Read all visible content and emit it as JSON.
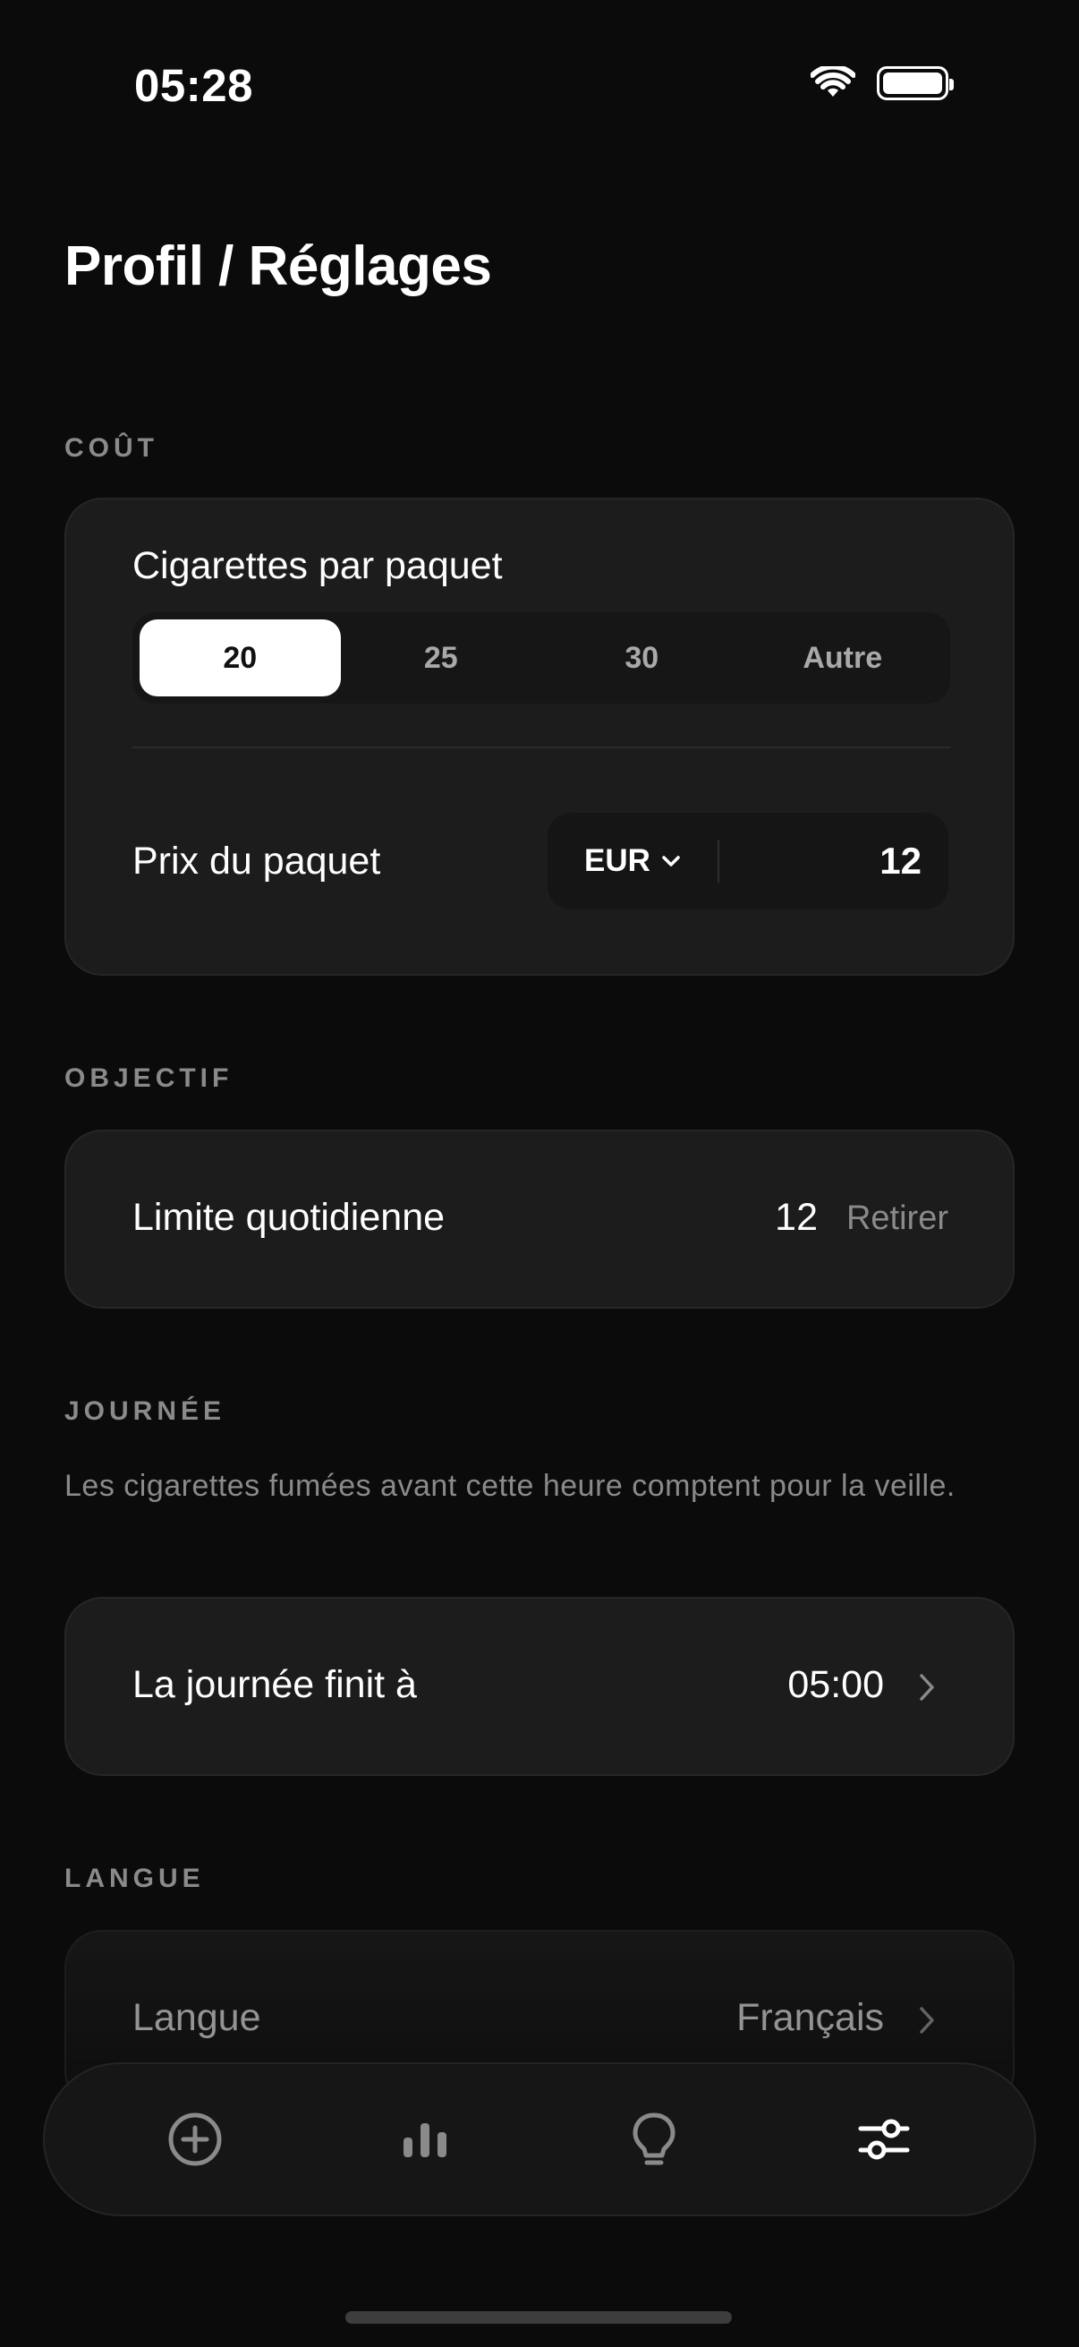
{
  "status_bar": {
    "time": "05:28",
    "wifi_icon": "wifi-icon",
    "battery_icon": "battery-icon"
  },
  "page": {
    "title": "Profil / Réglages"
  },
  "cost": {
    "section_label": "COÛT",
    "cigs_per_pack_label": "Cigarettes par paquet",
    "pack_options": [
      "20",
      "25",
      "30",
      "Autre"
    ],
    "selected_option": "20",
    "pack_price_label": "Prix du paquet",
    "currency": "EUR",
    "price": "12"
  },
  "goal": {
    "section_label": "OBJECTIF",
    "daily_limit_label": "Limite quotidienne",
    "daily_limit_value": "12",
    "remove_label": "Retirer"
  },
  "day": {
    "section_label": "JOURNÉE",
    "description": "Les cigarettes fumées avant cette heure comptent pour la veille.",
    "day_ends_label": "La journée finit à",
    "day_ends_value": "05:00"
  },
  "language": {
    "section_label": "LANGUE",
    "language_label": "Langue",
    "language_value": "Français"
  },
  "tab_bar": {
    "tabs": [
      {
        "icon": "add-circle-icon",
        "active": false
      },
      {
        "icon": "bar-chart-icon",
        "active": false
      },
      {
        "icon": "lightbulb-icon",
        "active": false
      },
      {
        "icon": "sliders-icon",
        "active": true
      }
    ]
  },
  "colors": {
    "background": "#0b0b0b",
    "card": "#1c1c1c",
    "muted_text": "#8a8a8a",
    "active_segment": "#ffffff"
  }
}
